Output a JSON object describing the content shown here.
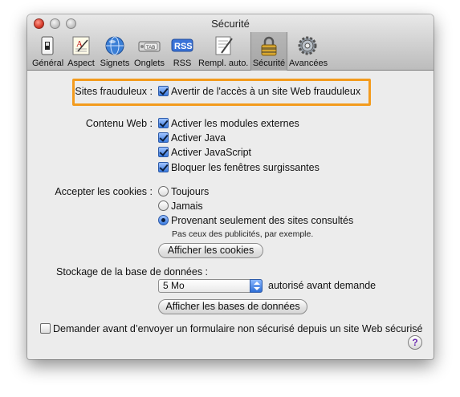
{
  "window": {
    "title": "Sécurité"
  },
  "toolbar": {
    "items": [
      {
        "label": "Général",
        "icon": "switch-icon"
      },
      {
        "label": "Aspect",
        "icon": "font-icon"
      },
      {
        "label": "Signets",
        "icon": "globe-icon"
      },
      {
        "label": "Onglets",
        "icon": "tab-icon"
      },
      {
        "label": "RSS",
        "icon": "rss-icon",
        "badge": "RSS"
      },
      {
        "label": "Rempl. auto.",
        "icon": "pen-icon"
      },
      {
        "label": "Sécurité",
        "icon": "lock-icon",
        "selected": true
      },
      {
        "label": "Avancées",
        "icon": "gear-icon"
      }
    ],
    "tab_icon_text": "TAB"
  },
  "fraud": {
    "label": "Sites frauduleux :",
    "checkbox_label": "Avertir de l'accès à un site Web frauduleux",
    "checked": true
  },
  "content": {
    "label": "Contenu Web :",
    "options": [
      {
        "label": "Activer les modules externes",
        "checked": true
      },
      {
        "label": "Activer Java",
        "checked": true
      },
      {
        "label": "Activer JavaScript",
        "checked": true
      },
      {
        "label": "Bloquer les fenêtres surgissantes",
        "checked": true
      }
    ]
  },
  "cookies": {
    "label": "Accepter les cookies :",
    "options": [
      {
        "label": "Toujours",
        "selected": false
      },
      {
        "label": "Jamais",
        "selected": false
      },
      {
        "label": "Provenant seulement des sites consultés",
        "selected": true
      }
    ],
    "hint": "Pas ceux des publicités, par exemple.",
    "button": "Afficher les cookies"
  },
  "storage": {
    "label": "Stockage de la base de données :",
    "select_value": "5 Mo",
    "suffix": "autorisé avant demande",
    "button": "Afficher les bases de données"
  },
  "insecure_form": {
    "label": "Demander avant d’envoyer un formulaire non sécurisé depuis un site Web sécurisé",
    "checked": false
  },
  "help": {
    "label": "?"
  },
  "colors": {
    "highlight": "#f39b1d",
    "accent": "#3a7be0"
  }
}
